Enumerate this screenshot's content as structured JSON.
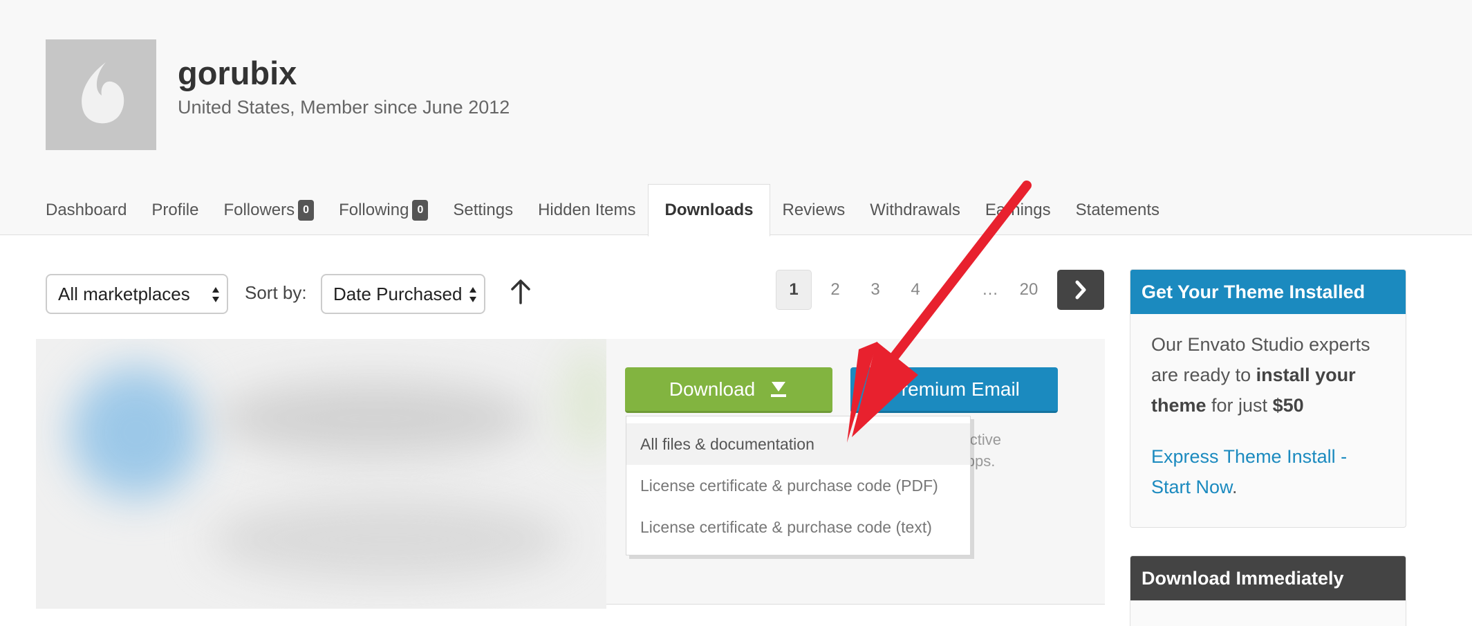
{
  "profile": {
    "username": "gorubix",
    "subtitle": "United States, Member since June 2012",
    "avatar_icon": "envato-leaf-icon"
  },
  "nav": {
    "tabs": [
      {
        "label": "Dashboard"
      },
      {
        "label": "Profile"
      },
      {
        "label": "Followers",
        "badge": "0"
      },
      {
        "label": "Following",
        "badge": "0"
      },
      {
        "label": "Settings"
      },
      {
        "label": "Hidden Items"
      },
      {
        "label": "Downloads",
        "active": true
      },
      {
        "label": "Reviews"
      },
      {
        "label": "Withdrawals"
      },
      {
        "label": "Earnings"
      },
      {
        "label": "Statements"
      }
    ]
  },
  "toolbar": {
    "marketplace_value": "All marketplaces",
    "sort_label": "Sort by:",
    "sort_value": "Date Purchased",
    "sort_direction_icon": "arrow-up-icon"
  },
  "pagination": {
    "pages": [
      "1",
      "2",
      "3",
      "4",
      "…",
      "20"
    ],
    "current": "1",
    "next_icon": "chevron-right-icon"
  },
  "item": {
    "download_label": "Download",
    "premium_email_label": "Premium Email",
    "description_line1": "oductive",
    "description_line2": "e Apps.",
    "dropdown": [
      "All files & documentation",
      "License certificate & purchase code (PDF)",
      "License certificate & purchase code (text)"
    ]
  },
  "sidebar": {
    "install_box": {
      "title": "Get Your Theme Installed",
      "text_a": "Our Envato Studio experts are ready to ",
      "text_b": "install your theme",
      "text_c": " for just ",
      "text_d": "$50",
      "link": "Express Theme Install - Start Now",
      "link_suffix": ".",
      "header_color": "#1b8abf"
    },
    "download_box": {
      "title": "Download Immediately",
      "header_color": "#444444"
    }
  },
  "colors": {
    "download_button": "#82b440",
    "premium_button": "#1b8abf",
    "annotation_arrow": "#e8212e"
  }
}
